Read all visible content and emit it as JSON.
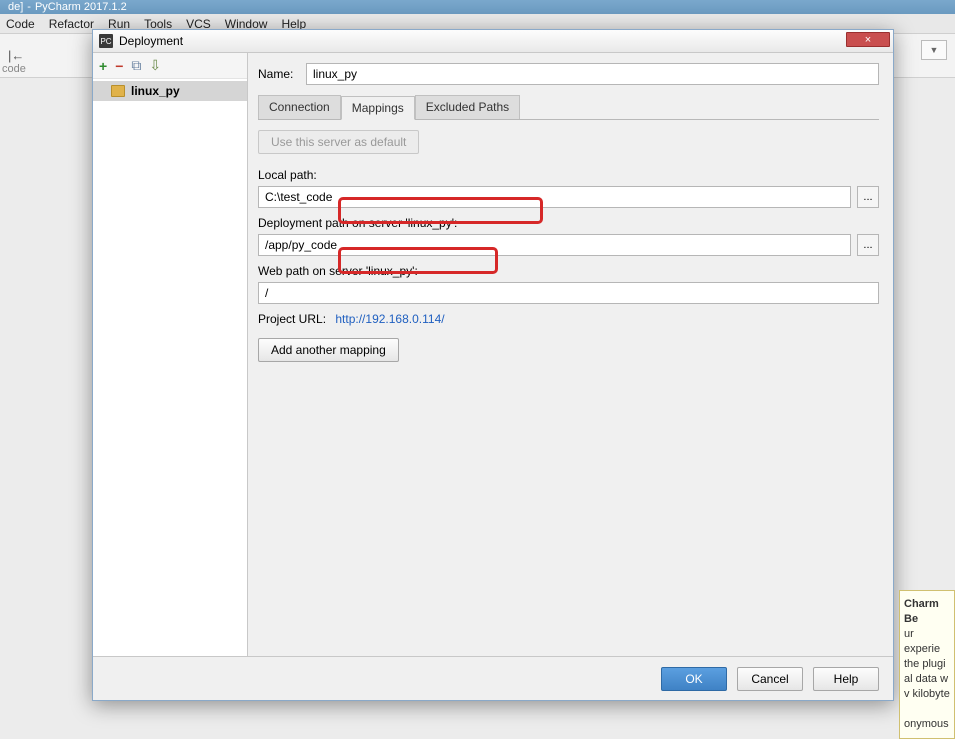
{
  "app": {
    "title_suffix": "PyCharm 2017.1.2",
    "title_prefix": "de]"
  },
  "menubar": {
    "items": [
      "Code",
      "Refactor",
      "Run",
      "Tools",
      "VCS",
      "Window",
      "Help"
    ]
  },
  "toolbar_stub": {
    "code_label": "code"
  },
  "dialog": {
    "title": "Deployment",
    "close_glyph": "×",
    "left_toolbar": {
      "add": "+",
      "remove": "−",
      "copy": "⧉",
      "import": "⇩"
    },
    "servers": [
      {
        "name": "linux_py"
      }
    ],
    "name_label": "Name:",
    "name_value": "linux_py",
    "tabs": [
      "Connection",
      "Mappings",
      "Excluded Paths"
    ],
    "active_tab": 1,
    "use_default_btn": "Use this server as default",
    "local_path_label": "Local path:",
    "local_path_value": "C:\\test_code",
    "deploy_path_label": "Deployment path on server 'linux_py':",
    "deploy_path_value": "/app/py_code",
    "web_path_label": "Web path on server 'linux_py':",
    "web_path_value": "/",
    "project_url_label": "Project URL:",
    "project_url_value": "http://192.168.0.114/",
    "add_mapping_btn": "Add another mapping",
    "browse_glyph": "...",
    "footer": {
      "ok": "OK",
      "cancel": "Cancel",
      "help": "Help"
    }
  },
  "notif": {
    "title": "Charm Be",
    "lines": [
      "ur experie",
      "the plugi",
      "al data w",
      "v kilobyte",
      "",
      "onymous"
    ]
  }
}
